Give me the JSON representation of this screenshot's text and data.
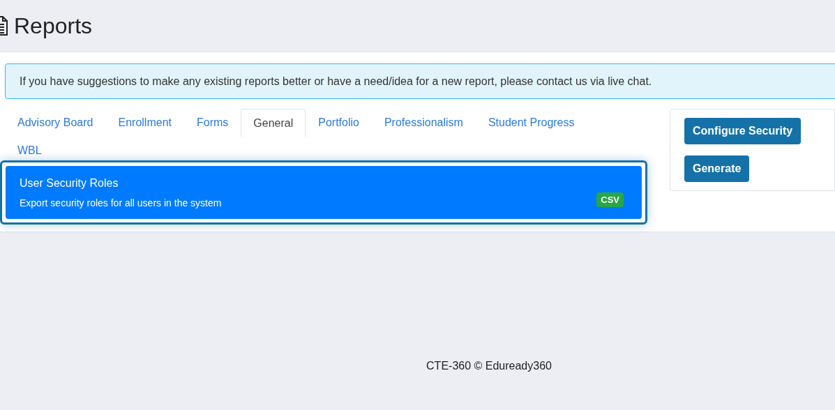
{
  "page": {
    "title": "Reports"
  },
  "notice": "If you have suggestions to make any existing reports better or have a need/idea for a new report, please contact us via live chat.",
  "tabs": [
    {
      "label": "Advisory Board",
      "selected": false
    },
    {
      "label": "Enrollment",
      "selected": false
    },
    {
      "label": "Forms",
      "selected": false
    },
    {
      "label": "General",
      "selected": true
    },
    {
      "label": "Portfolio",
      "selected": false
    },
    {
      "label": "Professionalism",
      "selected": false
    },
    {
      "label": "Student Progress",
      "selected": false
    },
    {
      "label": "WBL",
      "selected": false
    }
  ],
  "reports": [
    {
      "title": "User Security Roles",
      "description": "Export security roles for all users in the system",
      "format": "CSV",
      "selected": true
    }
  ],
  "actions": [
    "Configure Security",
    "Generate"
  ],
  "footer": "CTE-360 © Eduready360"
}
